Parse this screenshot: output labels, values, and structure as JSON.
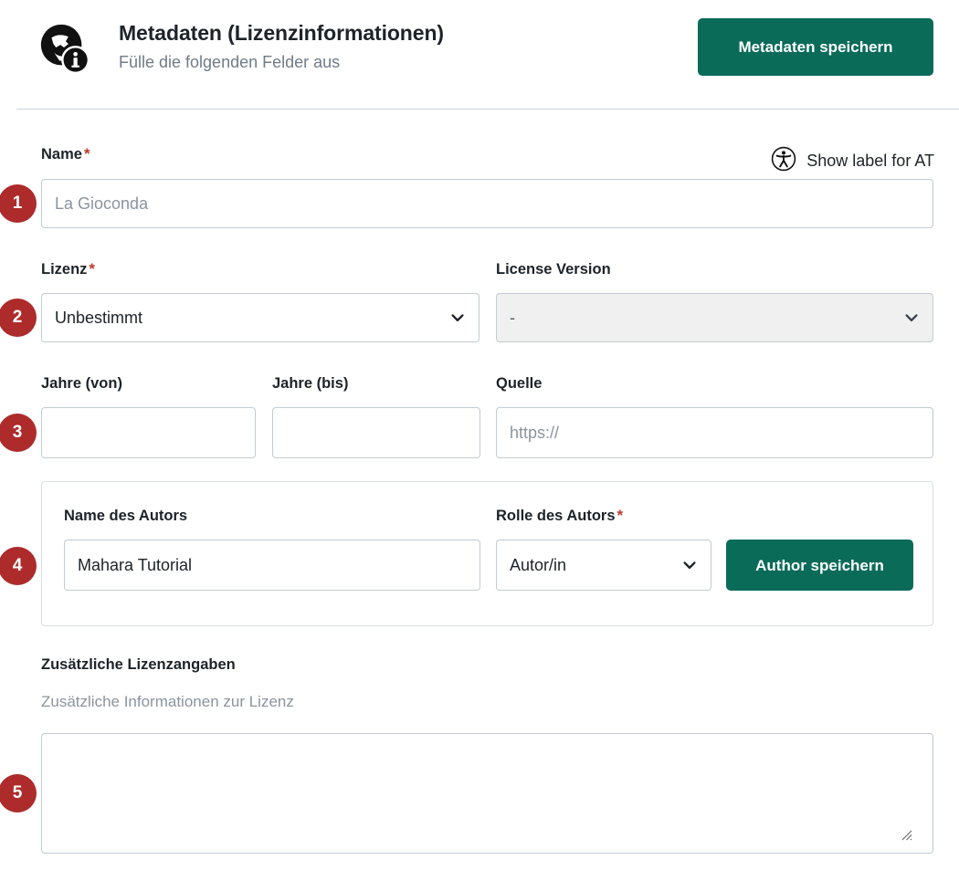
{
  "header": {
    "icon": "globe-info-icon",
    "title": "Metadaten (Lizenzinformationen)",
    "subtitle": "Fülle die folgenden Felder aus",
    "save_button_label": "Metadaten speichern"
  },
  "accent_colors": {
    "primary_button": "#0a6b59",
    "badge": "#ad2b2b",
    "required_asterisk": "#c0392b",
    "border": "#c2cbd4",
    "muted_text": "#8b949e",
    "disabled_background": "#f0f0f0"
  },
  "at_toggle": {
    "icon": "universal-access-icon",
    "label": "Show label for AT"
  },
  "badges": [
    "1",
    "2",
    "3",
    "4",
    "5"
  ],
  "fields": {
    "name": {
      "label": "Name",
      "required_marker": "*",
      "value": "",
      "placeholder": "La Gioconda"
    },
    "license": {
      "label": "Lizenz",
      "required_marker": "*",
      "value": "Unbestimmt",
      "icon": "chevron-down-icon"
    },
    "license_version": {
      "label": "License Version",
      "value": "-",
      "disabled": "true",
      "icon": "chevron-down-icon"
    },
    "years_from": {
      "label": "Jahre (von)",
      "value": "",
      "placeholder": ""
    },
    "years_to": {
      "label": "Jahre (bis)",
      "value": "",
      "placeholder": ""
    },
    "source": {
      "label": "Quelle",
      "value": "",
      "placeholder": "https://"
    },
    "author_name": {
      "label": "Name des Autors",
      "value": "Mahara Tutorial",
      "placeholder": ""
    },
    "author_role": {
      "label": "Rolle des Autors",
      "required_marker": "*",
      "value": "Autor/in",
      "icon": "chevron-down-icon"
    },
    "save_author_button": {
      "label": "Author speichern"
    },
    "additional_license": {
      "label": "Zusätzliche Lizenzangaben",
      "helper": "Zusätzliche Informationen zur Lizenz",
      "value": "",
      "placeholder": ""
    }
  }
}
